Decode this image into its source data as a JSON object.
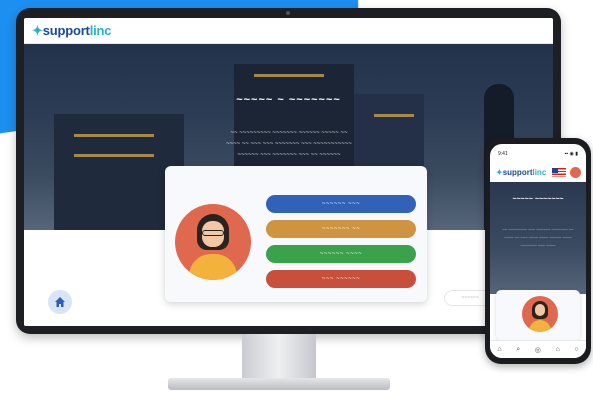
{
  "desktop": {
    "logo": {
      "mark": "✦",
      "brand": "support",
      "brand_suffix": "linc"
    },
    "hero": {
      "title": "~~~~~ ~ ~~~~~~~",
      "text_lines": [
        "~~ ~~~~~~~~~ ~~~~~~~ ~~~~~~ ~~~~~ ~~",
        "~~~~ ~~ ~~~ ~~~ ~~~~~~~ ~~~ ~~~~~~~~~~~",
        "~~~~~~ ~~~ ~~~~~~~ ~~~ ~~ ~~~~~~"
      ]
    },
    "buttons": [
      {
        "label": "~~~~~~ ~~~",
        "color": "#3262b8"
      },
      {
        "label": "~~~~~~~ ~~",
        "color": "#cf9442"
      },
      {
        "label": "~~~~~~ ~~~~",
        "color": "#3ba14a"
      },
      {
        "label": "~~~ ~~~~~~",
        "color": "#c84f3c"
      }
    ],
    "search_placeholder": "~~~~~~",
    "home_icon": "home-icon"
  },
  "phone": {
    "status_time": "9:41",
    "status_icons": "▪▪ ◉ ▮",
    "logo": {
      "mark": "✦",
      "brand": "support",
      "brand_suffix": "linc"
    },
    "hero_title": "~~~~~ ~~~~~~~",
    "hero_text": "~~ ~~~~~~~~ ~~~ ~~~~~~ ~~~~~~~ ~~ ~~~~ ~~ ~~~ ~~~~ ~~~~ ~~~~~ ~~~~ ~~~~~~~ ~~~ ~~~~",
    "nav_icons": [
      "⌂",
      "⌕",
      "◎",
      "⌂",
      "○"
    ]
  },
  "colors": {
    "accent": "#1c8ff0",
    "brand_blue": "#1a4aa0",
    "brand_teal": "#2bb0c9",
    "avatar_bg": "#e0684e"
  }
}
